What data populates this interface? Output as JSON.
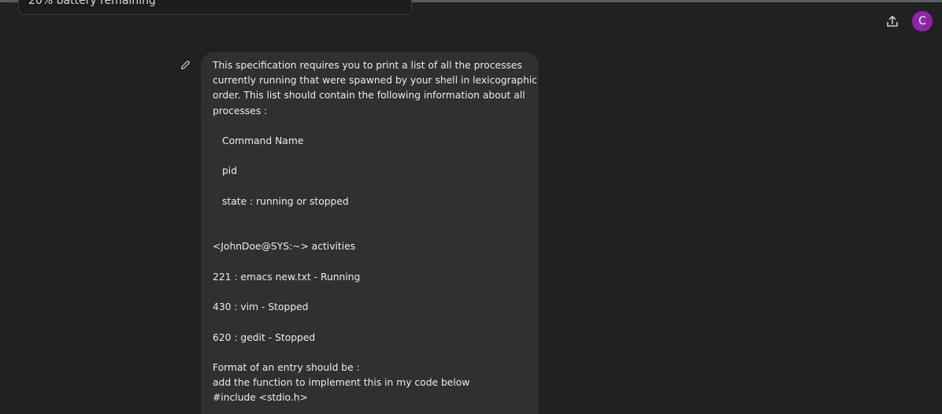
{
  "notification": {
    "text": "20% battery remaining"
  },
  "header": {
    "share_icon": "upload-icon",
    "avatar_letter": "C"
  },
  "message": {
    "edit_icon": "pencil-icon",
    "lines": [
      "This specification requires you to print a list of all the processes",
      "currently running that were spawned by your shell in lexicographic",
      "order. This list should contain the following information about all",
      "processes :",
      "Command Name",
      "pid",
      "state : running or stopped",
      "<JohnDoe@SYS:~> activities",
      "221 : emacs new.txt - Running",
      "430 : vim - Stopped",
      "620 : gedit - Stopped",
      "Format of an entry should be :",
      "add the function to implement this in my code below",
      "#include <stdio.h>"
    ]
  },
  "colors": {
    "background": "#212121",
    "bubble": "#303030",
    "avatar": "#8e24aa",
    "text": "#ececec"
  }
}
